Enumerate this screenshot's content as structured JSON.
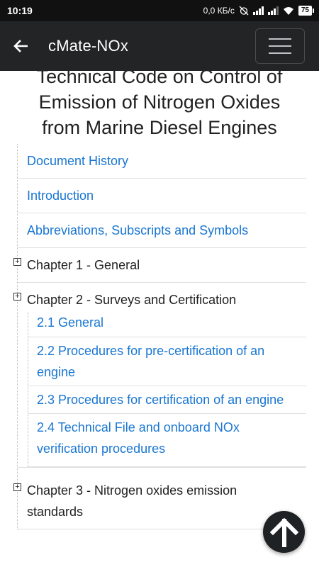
{
  "status_bar": {
    "time": "10:19",
    "network": "0,0 КБ/с",
    "battery": "75"
  },
  "app_bar": {
    "title": "cMate-NOx",
    "back_icon": "arrow-back-icon",
    "menu_icon": "hamburger-menu-icon"
  },
  "document": {
    "title_lines": [
      "Technical Code on Control of",
      "Emission of Nitrogen Oxides",
      "from Marine Diesel Engines"
    ]
  },
  "toc": {
    "links": [
      "Document History",
      "Introduction",
      "Abbreviations, Subscripts and Symbols"
    ],
    "chapters": [
      {
        "label": "Chapter 1 - General",
        "expanded": false,
        "items": []
      },
      {
        "label": "Chapter 2 - Surveys and Certification",
        "expanded": true,
        "items": [
          "2.1 General",
          "2.2 Procedures for pre-certification of an engine",
          "2.3 Procedures for certification of an engine",
          "2.4 Technical File and onboard NOx verification procedures"
        ]
      },
      {
        "label": "Chapter 3 - Nitrogen oxides emission standards",
        "expanded": false,
        "items": []
      }
    ]
  },
  "scroll_top_button": {
    "icon": "arrow-up-icon"
  },
  "colors": {
    "link": "#1976d2",
    "app_bar": "#222426",
    "status_bar": "#111111"
  }
}
